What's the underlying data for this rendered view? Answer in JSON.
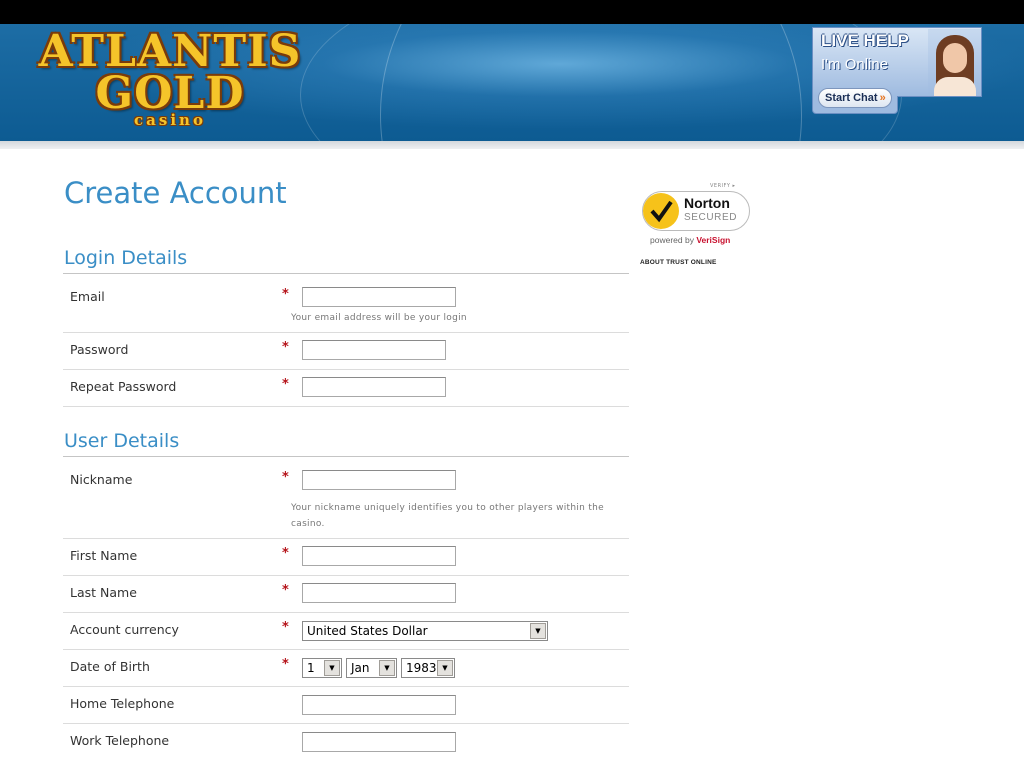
{
  "header": {
    "logo": {
      "line1": "ATLANTIS",
      "line2": "GOLD",
      "sub": "casino"
    },
    "live_help": {
      "title": "LIVE HELP",
      "status": "I'm Online",
      "chat_label": "Start Chat",
      "chat_arrows": "»"
    }
  },
  "page": {
    "title": "Create Account"
  },
  "login_section": {
    "title": "Login Details",
    "email": {
      "label": "Email",
      "required": "*",
      "value": "",
      "hint": "Your email address will be your login"
    },
    "password": {
      "label": "Password",
      "required": "*",
      "value": ""
    },
    "repeat_password": {
      "label": "Repeat Password",
      "required": "*",
      "value": ""
    }
  },
  "user_section": {
    "title": "User Details",
    "nickname": {
      "label": "Nickname",
      "required": "*",
      "value": "",
      "hint": "Your nickname uniquely identifies you to other players within the casino."
    },
    "first_name": {
      "label": "First Name",
      "required": "*",
      "value": ""
    },
    "last_name": {
      "label": "Last Name",
      "required": "*",
      "value": ""
    },
    "currency": {
      "label": "Account currency",
      "required": "*",
      "value": "United States Dollar"
    },
    "dob": {
      "label": "Date of Birth",
      "required": "*",
      "day": "1",
      "month": "Jan",
      "year": "1983"
    },
    "home_phone": {
      "label": "Home Telephone",
      "value": ""
    },
    "work_phone": {
      "label": "Work Telephone",
      "value": ""
    }
  },
  "trust": {
    "verify": "VERIFY ▸",
    "name": "Norton",
    "secured": "SECURED",
    "powered_prefix": "powered by ",
    "powered_brand": "VeriSign",
    "about_link": "ABOUT TRUST ONLINE"
  },
  "colors": {
    "accent": "#3a8ec6",
    "required": "#b5141a",
    "header": "#0d5b92"
  }
}
